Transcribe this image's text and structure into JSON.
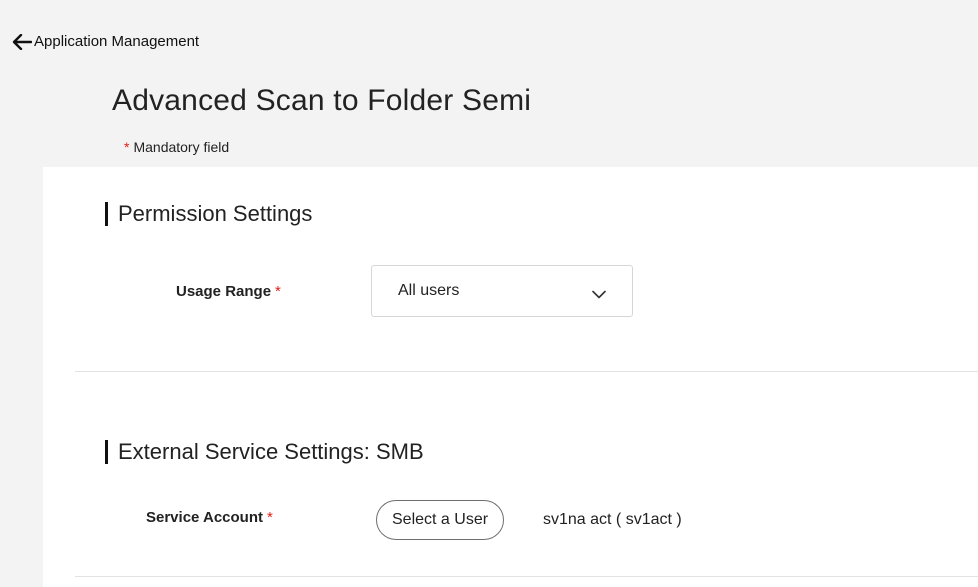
{
  "nav": {
    "back_label": "Application Management"
  },
  "header": {
    "title": "Advanced Scan to Folder Semi",
    "mandatory_star": "*",
    "mandatory_note": "Mandatory field"
  },
  "permission_settings": {
    "heading": "Permission Settings",
    "usage_range": {
      "label": "Usage Range",
      "required_mark": "*",
      "selected_value": "All users"
    }
  },
  "external_service": {
    "heading": "External Service Settings: SMB",
    "service_account": {
      "label": "Service Account",
      "required_mark": "*",
      "button_label": "Select a User",
      "selected_account": "sv1na act ( sv1act )"
    }
  },
  "colors": {
    "page_background": "#f3f3f3",
    "panel_background": "#ffffff",
    "required_star": "#e0201b",
    "divider": "#e3e3e3"
  },
  "icons": {
    "back": "arrow-left-icon",
    "dropdown": "chevron-down-icon"
  }
}
